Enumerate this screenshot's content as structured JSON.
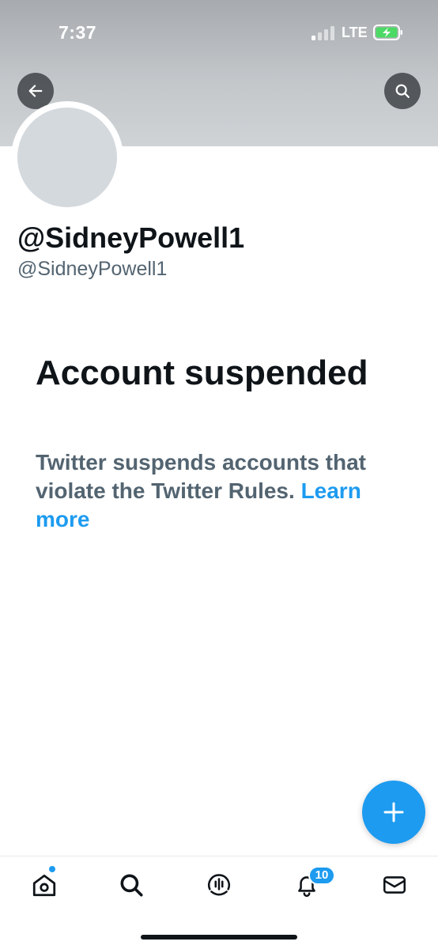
{
  "status_bar": {
    "time": "7:37",
    "network": "LTE",
    "icons": [
      "signal-icon",
      "battery-charging-icon"
    ]
  },
  "header": {
    "back_icon": "arrow-left-icon",
    "search_icon": "search-icon"
  },
  "profile": {
    "display_name": "@SidneyPowell1",
    "handle": "@SidneyPowell1"
  },
  "suspension": {
    "title": "Account suspended",
    "body": "Twitter suspends accounts that violate the Twitter Rules.",
    "link_label": "Learn more"
  },
  "fab": {
    "icon": "plus-icon"
  },
  "tab_bar": {
    "items": [
      {
        "name": "home",
        "icon": "home-icon"
      },
      {
        "name": "search",
        "icon": "search-icon"
      },
      {
        "name": "spaces",
        "icon": "spaces-icon"
      },
      {
        "name": "notifications",
        "icon": "bell-icon",
        "badge": "10"
      },
      {
        "name": "messages",
        "icon": "mail-icon"
      }
    ]
  },
  "colors": {
    "accent": "#1d9bf0",
    "text_primary": "#0f1419",
    "text_secondary": "#536471",
    "avatar_placeholder": "#d4d9de",
    "battery_charging": "#4cd964"
  }
}
